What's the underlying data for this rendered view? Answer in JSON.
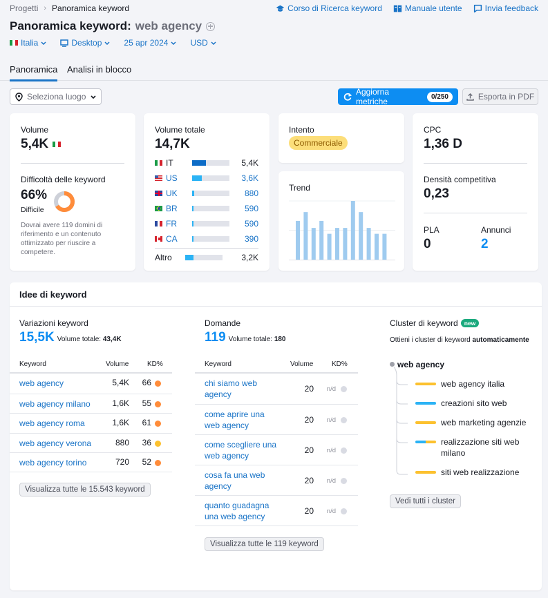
{
  "colors": {
    "accent": "#0d8df2",
    "link": "#1a74c7",
    "orange": "#ff8c3a",
    "yellow": "#fcc12f",
    "grey_dot": "#d9dbe3",
    "trend_bar": "#9fcbef"
  },
  "breadcrumb": {
    "root": "Progetti",
    "current": "Panoramica keyword"
  },
  "top_links": [
    {
      "icon": "graduation-cap-icon",
      "label": "Corso di Ricerca keyword"
    },
    {
      "icon": "book-icon",
      "label": "Manuale utente"
    },
    {
      "icon": "chat-icon",
      "label": "Invia feedback"
    }
  ],
  "header": {
    "title": "Panoramica keyword:",
    "keyword": "web agency"
  },
  "filters": {
    "country": "Italia",
    "device": "Desktop",
    "date": "25 apr 2024",
    "currency": "USD"
  },
  "tabs": [
    {
      "label": "Panoramica",
      "active": true
    },
    {
      "label": "Analisi in blocco",
      "active": false
    }
  ],
  "toolbar": {
    "location_placeholder": "Seleziona luogo",
    "refresh_label": "Aggiorna metriche",
    "refresh_count": "0/250",
    "export_label": "Esporta in PDF"
  },
  "volume_card": {
    "label": "Volume",
    "value": "5,4K",
    "kd_label": "Difficoltà delle keyword",
    "kd_value": "66%",
    "kd_percent": 66,
    "kd_level": "Difficile",
    "kd_description": "Dovrai avere 119 domini di riferimento e un contenuto ottimizzato per riuscire a competere."
  },
  "global_card": {
    "label": "Volume totale",
    "value": "14,7K",
    "countries": [
      {
        "code": "IT",
        "value": "5,4K",
        "share": 0.37,
        "link": false
      },
      {
        "code": "US",
        "value": "3,6K",
        "share": 0.25,
        "link": true
      },
      {
        "code": "UK",
        "value": "880",
        "share": 0.06,
        "link": true
      },
      {
        "code": "BR",
        "value": "590",
        "share": 0.04,
        "link": true
      },
      {
        "code": "FR",
        "value": "590",
        "share": 0.04,
        "link": true
      },
      {
        "code": "CA",
        "value": "390",
        "share": 0.03,
        "link": true
      }
    ],
    "other": {
      "label": "Altro",
      "value": "3,2K",
      "share": 0.22
    }
  },
  "intent_card": {
    "label": "Intento",
    "value": "Commerciale"
  },
  "trend_card": {
    "label": "Trend",
    "values": [
      66,
      81,
      54,
      66,
      44,
      54,
      54,
      100,
      81,
      54,
      44,
      44
    ]
  },
  "cpc_card": {
    "cpc_label": "CPC",
    "cpc_value": "1,36 D",
    "density_label": "Densità competitiva",
    "density_value": "0,23",
    "pla_label": "PLA",
    "pla_value": "0",
    "ads_label": "Annunci",
    "ads_value": "2"
  },
  "ideas": {
    "title": "Idee di keyword",
    "variations": {
      "title": "Variazioni keyword",
      "count": "15,5K",
      "total_label": "Volume totale:",
      "total_value": "43,4K",
      "headers": {
        "keyword": "Keyword",
        "volume": "Volume",
        "kd": "KD%"
      },
      "rows": [
        {
          "keyword": "web agency",
          "volume": "5,4K",
          "kd": "66",
          "level": "orange"
        },
        {
          "keyword": "web agency milano",
          "volume": "1,6K",
          "kd": "55",
          "level": "orange"
        },
        {
          "keyword": "web agency roma",
          "volume": "1,6K",
          "kd": "61",
          "level": "orange"
        },
        {
          "keyword": "web agency verona",
          "volume": "880",
          "kd": "36",
          "level": "yellow"
        },
        {
          "keyword": "web agency torino",
          "volume": "720",
          "kd": "52",
          "level": "orange"
        }
      ],
      "button": "Visualizza tutte le 15.543 keyword"
    },
    "questions": {
      "title": "Domande",
      "count": "119",
      "total_label": "Volume totale:",
      "total_value": "180",
      "headers": {
        "keyword": "Keyword",
        "volume": "Volume",
        "kd": "KD%"
      },
      "rows": [
        {
          "keyword_l1": "chi siamo web",
          "keyword_l2": "agency",
          "volume": "20",
          "kd": "n/d"
        },
        {
          "keyword_l1": "come aprire una",
          "keyword_l2": "web agency",
          "volume": "20",
          "kd": "n/d"
        },
        {
          "keyword_l1": "come scegliere una",
          "keyword_l2": "web agency",
          "volume": "20",
          "kd": "n/d"
        },
        {
          "keyword_l1": "cosa fa una web",
          "keyword_l2": "agency",
          "volume": "20",
          "kd": "n/d"
        },
        {
          "keyword_l1": "quanto guadagna",
          "keyword_l2": "una web agency",
          "volume": "20",
          "kd": "n/d"
        }
      ],
      "button": "Visualizza tutte le 119 keyword"
    },
    "clusters": {
      "title": "Cluster di keyword",
      "badge": "new",
      "subtitle_prefix": "Ottieni i cluster di keyword",
      "subtitle_bold": "automaticamente",
      "root": "web agency",
      "items": [
        {
          "label": "web agency italia",
          "colors": [
            "yellow"
          ]
        },
        {
          "label": "creazioni sito web",
          "colors": [
            "blue"
          ]
        },
        {
          "label": "web marketing agenzie",
          "colors": [
            "yellow"
          ]
        },
        {
          "label": "realizzazione siti web milano",
          "colors": [
            "blue",
            "yellow"
          ]
        },
        {
          "label": "siti web realizzazione",
          "colors": [
            "yellow"
          ]
        }
      ],
      "button": "Vedi tutti i cluster"
    }
  }
}
